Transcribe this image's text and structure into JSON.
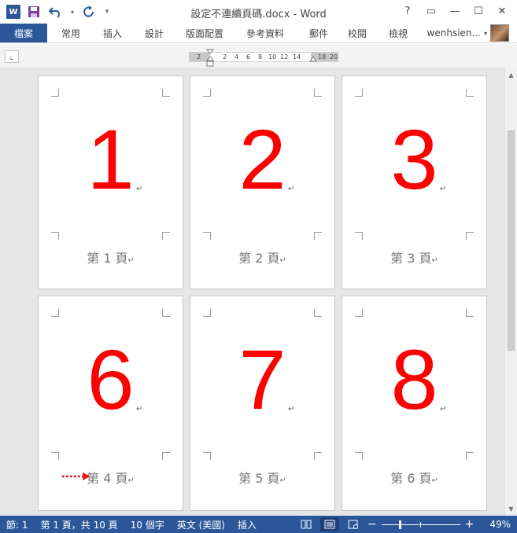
{
  "window": {
    "title": "設定不連續頁碼.docx - Word",
    "help": "?",
    "ribbon_display": "▭",
    "minimize": "—",
    "maximize": "☐",
    "close": "✕"
  },
  "qat": {
    "logo": "W",
    "customize": "▾"
  },
  "tabs": {
    "file": "檔案",
    "home": "常用",
    "insert": "插入",
    "design": "設計",
    "layout": "版面配置",
    "references": "參考資料",
    "mailings": "郵件",
    "review": "校閱",
    "view": "檢視",
    "user": "wenhsien...",
    "user_menu": "▾"
  },
  "ruler": {
    "corner": "⌞",
    "numbers": [
      "2",
      "2",
      "4",
      "6",
      "8",
      "10",
      "12",
      "14",
      "18",
      "20"
    ]
  },
  "pages": [
    {
      "number": "1",
      "footer": "第 1 頁"
    },
    {
      "number": "2",
      "footer": "第 2 頁"
    },
    {
      "number": "3",
      "footer": "第 3 頁"
    },
    {
      "number": "6",
      "footer": "第 4 頁"
    },
    {
      "number": "7",
      "footer": "第 5 頁"
    },
    {
      "number": "8",
      "footer": "第 6 頁"
    }
  ],
  "para_mark": "↵",
  "status": {
    "section": "節: 1",
    "page": "第 1 頁，共 10 頁",
    "words": "10 個字",
    "language": "英文 (美國)",
    "mode": "插入",
    "zoom_minus": "−",
    "zoom_plus": "+",
    "zoom": "49%"
  },
  "colors": {
    "accent": "#2b579a",
    "page_number": "#ff0000",
    "arrow": "#e02020"
  },
  "icons": {
    "save": "save-icon",
    "undo": "undo-icon",
    "redo": "redo-icon",
    "read_mode": "read-mode-icon",
    "print_layout": "print-layout-icon",
    "web_layout": "web-layout-icon"
  }
}
